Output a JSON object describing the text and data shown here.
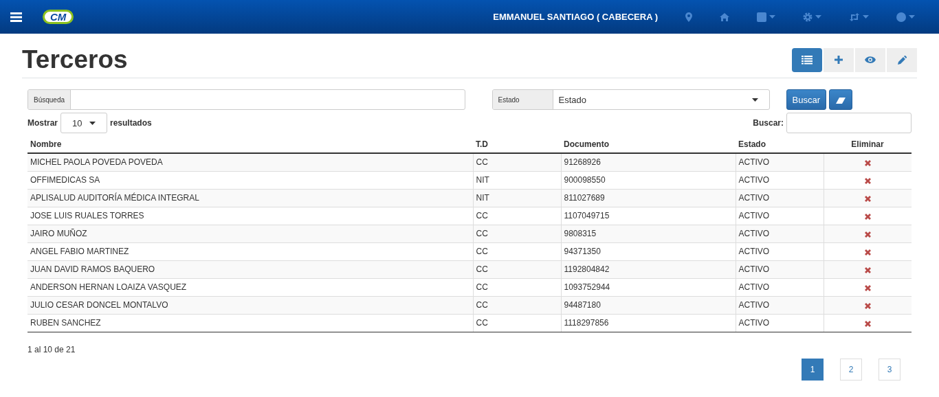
{
  "navbar": {
    "logo": "CM",
    "user": "EMMANUEL SANTIAGO ( CABECERA )",
    "menus": [
      {
        "kind": "pin",
        "dropdown": false
      },
      {
        "kind": "home",
        "dropdown": false
      },
      {
        "kind": "square",
        "dropdown": true
      },
      {
        "kind": "gear",
        "dropdown": true
      },
      {
        "kind": "sync",
        "dropdown": true
      },
      {
        "kind": "circle",
        "dropdown": true
      }
    ]
  },
  "page_title": "Terceros",
  "toolbar": [
    {
      "kind": "list",
      "selected": true
    },
    {
      "kind": "plus",
      "selected": false
    },
    {
      "kind": "eye",
      "selected": false
    },
    {
      "kind": "pencil",
      "selected": false
    }
  ],
  "filters": {
    "search_label": "Búsqueda",
    "state_label": "Estado",
    "state_value": "Estado",
    "search_button": "Buscar"
  },
  "length": {
    "before": "Mostrar",
    "value": "10",
    "after": "resultados"
  },
  "quick_search": {
    "label": "Buscar:"
  },
  "table": {
    "columns": [
      "Nombre",
      "T.D",
      "Documento",
      "Estado",
      "Eliminar"
    ],
    "rows": [
      {
        "name": "MICHEL PAOLA POVEDA POVEDA",
        "td": "CC",
        "doc": "91268926",
        "state": "ACTIVO"
      },
      {
        "name": "OFFIMEDICAS SA",
        "td": "NIT",
        "doc": "900098550",
        "state": "ACTIVO"
      },
      {
        "name": "APLISALUD AUDITORÍA MÉDICA INTEGRAL",
        "td": "NIT",
        "doc": "811027689",
        "state": "ACTIVO"
      },
      {
        "name": "JOSE LUIS RUALES TORRES",
        "td": "CC",
        "doc": "1107049715",
        "state": "ACTIVO"
      },
      {
        "name": "JAIRO MUÑOZ",
        "td": "CC",
        "doc": "9808315",
        "state": "ACTIVO"
      },
      {
        "name": "ANGEL FABIO MARTINEZ",
        "td": "CC",
        "doc": "94371350",
        "state": "ACTIVO"
      },
      {
        "name": "JUAN DAVID RAMOS BAQUERO",
        "td": "CC",
        "doc": "1192804842",
        "state": "ACTIVO"
      },
      {
        "name": "ANDERSON HERNAN LOAIZA VASQUEZ",
        "td": "CC",
        "doc": "1093752944",
        "state": "ACTIVO"
      },
      {
        "name": "JULIO CESAR DONCEL MONTALVO",
        "td": "CC",
        "doc": "94487180",
        "state": "ACTIVO"
      },
      {
        "name": "RUBEN SANCHEZ",
        "td": "CC",
        "doc": "1118297856",
        "state": "ACTIVO"
      }
    ]
  },
  "info": "1 al 10 de 21",
  "pagination": [
    {
      "label": "1",
      "selected": true
    },
    {
      "label": "2",
      "selected": false
    },
    {
      "label": "3",
      "selected": false
    }
  ]
}
